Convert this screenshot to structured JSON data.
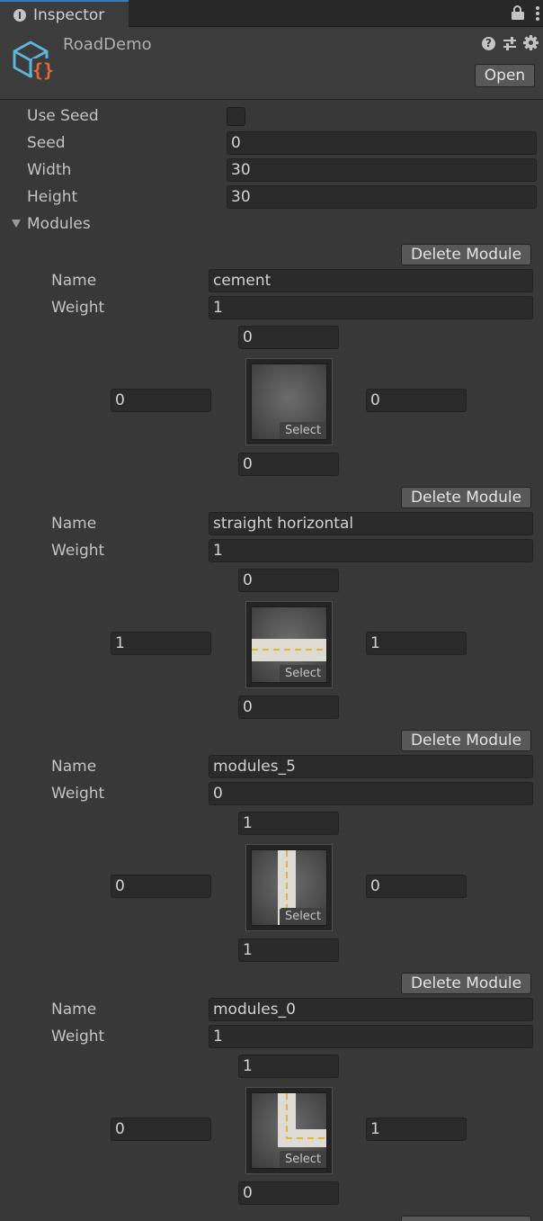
{
  "tab": {
    "label": "Inspector",
    "icon": "info-icon"
  },
  "header": {
    "title": "RoadDemo",
    "open_label": "Open",
    "icons": [
      "script-icon",
      "help-icon",
      "preset-icon",
      "gear-icon"
    ]
  },
  "fields": {
    "use_seed": {
      "label": "Use Seed",
      "checked": false
    },
    "seed": {
      "label": "Seed",
      "value": "0"
    },
    "width": {
      "label": "Width",
      "value": "30"
    },
    "height": {
      "label": "Height",
      "value": "30"
    }
  },
  "modules_label": "Modules",
  "labels": {
    "name": "Name",
    "weight": "Weight",
    "delete": "Delete Module",
    "select": "Select"
  },
  "modules": [
    {
      "name": "cement",
      "weight": "1",
      "top": "0",
      "left": "0",
      "right": "0",
      "bottom": "0",
      "sprite": "cement"
    },
    {
      "name": "straight horizontal",
      "weight": "1",
      "top": "0",
      "left": "1",
      "right": "1",
      "bottom": "0",
      "sprite": "road-horizontal"
    },
    {
      "name": "modules_5",
      "weight": "0",
      "top": "1",
      "left": "0",
      "right": "0",
      "bottom": "1",
      "sprite": "road-vertical"
    },
    {
      "name": "modules_0",
      "weight": "1",
      "top": "1",
      "left": "0",
      "right": "1",
      "bottom": "0",
      "sprite": "road-corner-top-right"
    }
  ],
  "colors": {
    "background": "#383838",
    "field": "#2a2a2a",
    "button": "#585858",
    "accent": "#3a79bb",
    "road_line": "#dcb83a"
  }
}
